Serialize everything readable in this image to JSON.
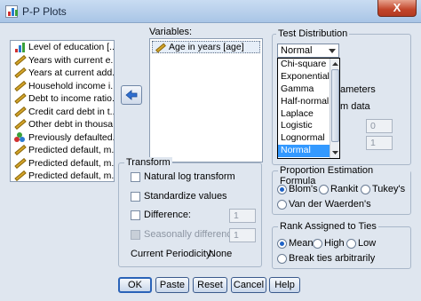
{
  "window": {
    "title": "P-P Plots",
    "close_label": "X"
  },
  "source_variables": [
    {
      "label": "Level of education [...",
      "icon": "ordinal-bars-icon"
    },
    {
      "label": "Years with current e...",
      "icon": "scale-ruler-icon"
    },
    {
      "label": "Years at current add...",
      "icon": "scale-ruler-icon"
    },
    {
      "label": "Household income i...",
      "icon": "scale-ruler-icon"
    },
    {
      "label": "Debt to income ratio...",
      "icon": "scale-ruler-icon"
    },
    {
      "label": "Credit card debt in t...",
      "icon": "scale-ruler-icon"
    },
    {
      "label": "Other debt in thousa...",
      "icon": "scale-ruler-icon"
    },
    {
      "label": "Previously defaulted...",
      "icon": "nominal-balls-icon"
    },
    {
      "label": "Predicted default, m...",
      "icon": "scale-ruler-icon"
    },
    {
      "label": "Predicted default, m...",
      "icon": "scale-ruler-icon"
    },
    {
      "label": "Predicted default, m...",
      "icon": "scale-ruler-icon"
    }
  ],
  "variables": {
    "label": "Variables:",
    "items": [
      "Age in years [age]"
    ]
  },
  "test_distribution": {
    "title": "Test Distribution",
    "selected": "Normal",
    "options": [
      "Chi-square",
      "Exponential",
      "Gamma",
      "Half-normal",
      "Laplace",
      "Logistic",
      "Lognormal",
      "Normal"
    ],
    "hidden_param_label": "ameters",
    "hidden_estimate_label": "m data",
    "param_values": [
      "0",
      "1"
    ]
  },
  "transform": {
    "title": "Transform",
    "natural_log": "Natural log transform",
    "standardize": "Standardize values",
    "difference": "Difference:",
    "difference_value": "1",
    "seasonal": "Seasonally difference:",
    "seasonal_value": "1",
    "periodicity_label": "Current Periodicity:",
    "periodicity_value": "None"
  },
  "proportion": {
    "title": "Proportion Estimation Formula",
    "options": [
      "Blom's",
      "Rankit",
      "Tukey's",
      "Van der Waerden's"
    ],
    "selected": "Blom's"
  },
  "ties": {
    "title": "Rank Assigned to Ties",
    "options": [
      "Mean",
      "High",
      "Low",
      "Break ties arbitrarily"
    ],
    "selected": "Mean"
  },
  "buttons": {
    "ok": "OK",
    "paste": "Paste",
    "reset": "Reset",
    "cancel": "Cancel",
    "help": "Help"
  },
  "colors": {
    "accent": "#2a63b8",
    "selection": "#3399ff",
    "close": "#c2452a",
    "window_bg": "#dfe6ef"
  }
}
